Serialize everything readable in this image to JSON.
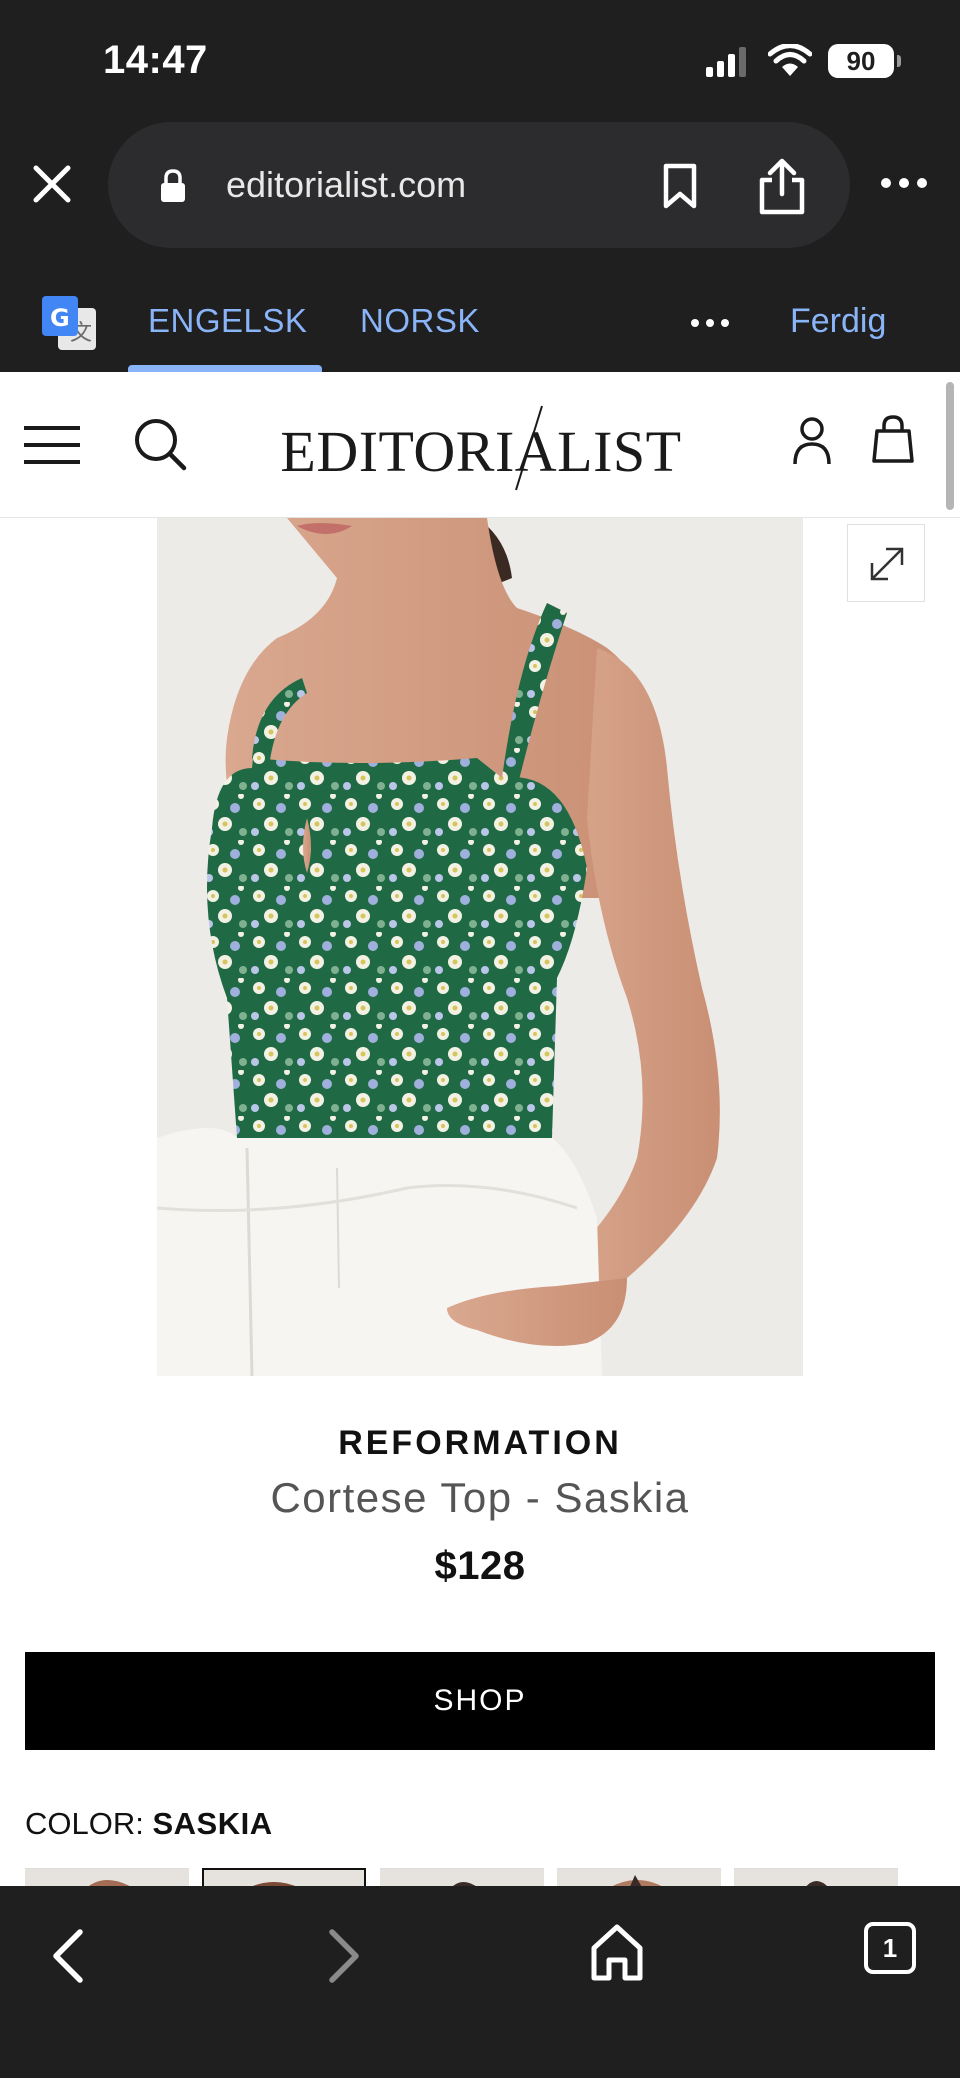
{
  "status_bar": {
    "time": "14:47",
    "battery": "90"
  },
  "browser": {
    "url": "editorialist.com",
    "icons": [
      "close-icon",
      "lock-icon",
      "bookmark-icon",
      "share-icon",
      "more-icon"
    ]
  },
  "translate_bar": {
    "tabs": [
      {
        "label": "ENGELSK",
        "selected": true
      },
      {
        "label": "NORSK",
        "selected": false
      }
    ],
    "done_label": "Ferdig"
  },
  "site_header": {
    "logo": "EDITORIALIST",
    "icons": [
      "menu-icon",
      "search-icon",
      "account-icon",
      "bag-icon"
    ]
  },
  "product": {
    "brand": "REFORMATION",
    "name": "Cortese Top - Saskia",
    "price": "$128",
    "shop_label": "SHOP",
    "color_label": "COLOR:",
    "color_value": "SASKIA",
    "selected_swatch": 2
  },
  "bottom_toolbar": {
    "tab_count": "1",
    "icons": [
      "back-icon",
      "forward-icon",
      "home-icon",
      "tabs-icon"
    ]
  }
}
